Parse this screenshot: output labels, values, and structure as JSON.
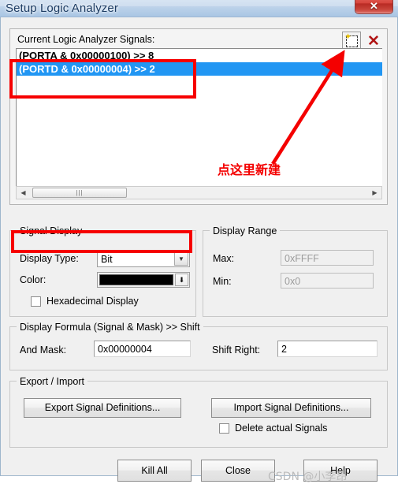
{
  "window": {
    "title": "Setup Logic Analyzer",
    "close_glyph": "✕"
  },
  "signals_panel": {
    "label": "Current Logic Analyzer Signals:",
    "new_button_tooltip": "New",
    "new_icon": "new-document-icon",
    "delete_icon": "red-x-delete-icon",
    "delete_glyph": "✕",
    "rows": [
      {
        "text": "(PORTA & 0x00000100) >> 8",
        "selected": false
      },
      {
        "text": "(PORTD & 0x00000004) >> 2",
        "selected": true
      }
    ],
    "scrollbar": {
      "left_arrow": "◀",
      "right_arrow": "▶",
      "thumb_grip": "|||"
    }
  },
  "signal_display": {
    "title": "Signal Display",
    "display_type_label": "Display Type:",
    "display_type_value": "Bit",
    "display_type_arrow": "▼",
    "color_label": "Color:",
    "color_value": "#000000",
    "color_arrow": "⬇",
    "hex_checkbox_label": "Hexadecimal Display",
    "hex_checkbox_checked": false
  },
  "display_range": {
    "title": "Display Range",
    "max_label": "Max:",
    "max_value": "0xFFFF",
    "min_label": "Min:",
    "min_value": "0x0",
    "disabled": true
  },
  "display_formula": {
    "title": "Display Formula (Signal & Mask) >> Shift",
    "and_mask_label": "And Mask:",
    "and_mask_value": "0x00000004",
    "shift_right_label": "Shift Right:",
    "shift_right_value": "2"
  },
  "export_import": {
    "title": "Export / Import",
    "export_button": "Export Signal Definitions...",
    "import_button": "Import Signal Definitions...",
    "delete_checkbox_label": "Delete actual Signals",
    "delete_checkbox_checked": false
  },
  "footer": {
    "kill_all_button": "Kill All",
    "close_button": "Close",
    "help_button": "Help"
  },
  "annotations": {
    "callout_text": "点这里新建",
    "highlight_color": "#f60000",
    "watermark": "CSDN @小李昂"
  }
}
